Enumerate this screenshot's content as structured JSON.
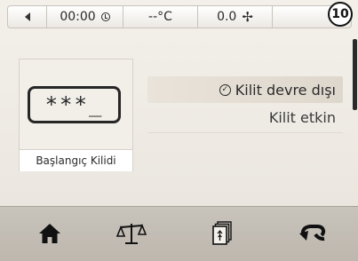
{
  "statusbar": {
    "time": "00:00",
    "temperature": "--°C",
    "fan": "0.0",
    "step_number": "10"
  },
  "lock_card": {
    "password_mask": "***_",
    "label": "Başlangıç Kilidi"
  },
  "options": {
    "disabled_label": "Kilit devre dışı",
    "enabled_label": "Kilit etkin"
  },
  "icons": {
    "back": "back-arrow-icon",
    "clock": "clock-icon",
    "fan": "fan-icon",
    "home": "home-icon",
    "scale": "scale-icon",
    "cards": "cards-icon",
    "return": "return-icon"
  }
}
